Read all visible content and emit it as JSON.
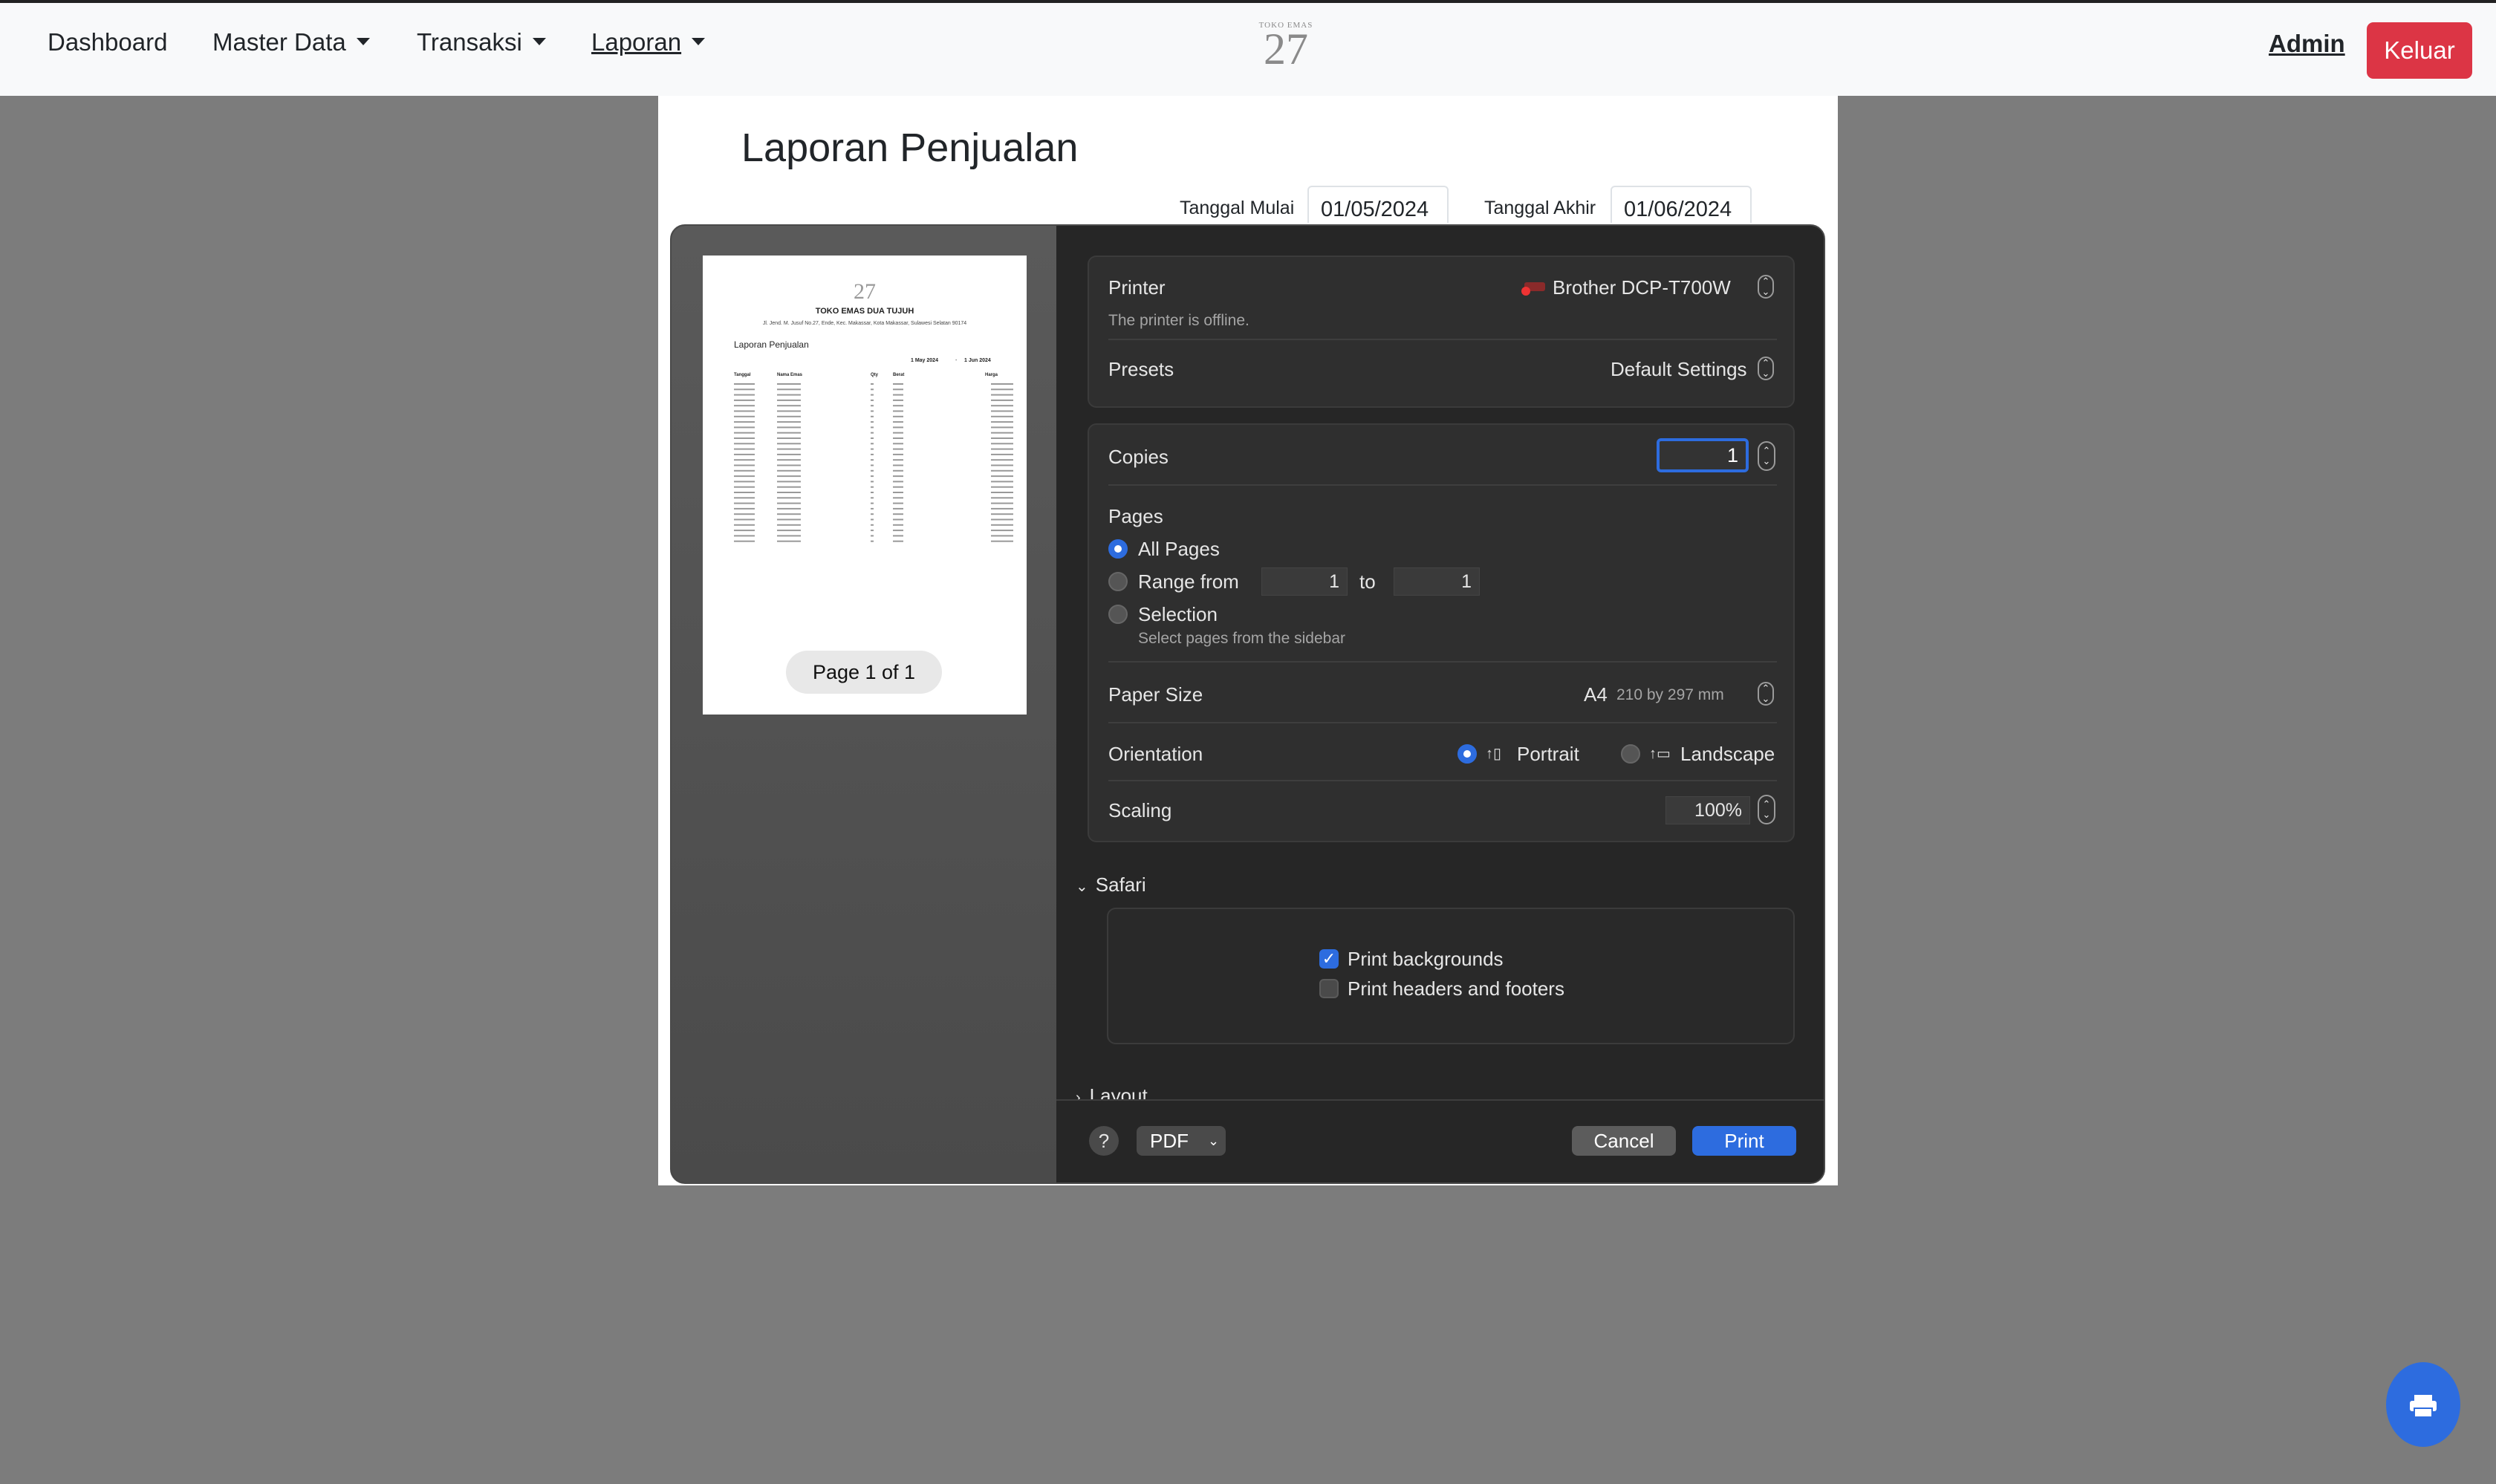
{
  "navbar": {
    "dashboard": "Dashboard",
    "master_data": "Master Data",
    "transaksi": "Transaksi",
    "laporan": "Laporan",
    "logo_small": "TOKO EMAS",
    "logo_big": "27",
    "admin": "Admin",
    "logout": "Keluar"
  },
  "report": {
    "title": "Laporan Penjualan",
    "start_label": "Tanggal Mulai",
    "start_value": "01/05/2024",
    "end_label": "Tanggal Akhir",
    "end_value": "01/06/2024"
  },
  "preview": {
    "logo": "27",
    "store_name": "TOKO EMAS DUA TUJUH",
    "address": "Jl. Jend. M. Jusuf No.27, Ende, Kec. Makassar, Kota Makassar, Sulawesi Selatan 90174",
    "title": "Laporan Penjualan",
    "date_from": "1 May 2024",
    "date_sep": "-",
    "date_to": "1 Jun 2024",
    "columns": [
      "Tanggal",
      "Nama Emas",
      "Qty",
      "Berat",
      "Harga"
    ],
    "page_indicator": "Page 1 of 1"
  },
  "print_dialog": {
    "printer_label": "Printer",
    "printer_value": "Brother DCP-T700W",
    "printer_status": "The printer is offline.",
    "presets_label": "Presets",
    "presets_value": "Default Settings",
    "copies_label": "Copies",
    "copies_value": "1",
    "pages_label": "Pages",
    "all_pages": "All Pages",
    "range_from": "Range from",
    "range_start": "1",
    "range_to": "to",
    "range_end": "1",
    "selection": "Selection",
    "selection_hint": "Select pages from the sidebar",
    "paper_size_label": "Paper Size",
    "paper_size_value": "A4",
    "paper_size_detail": "210 by 297 mm",
    "orientation_label": "Orientation",
    "portrait": "Portrait",
    "landscape": "Landscape",
    "scaling_label": "Scaling",
    "scaling_value": "100%",
    "safari_section": "Safari",
    "print_backgrounds": "Print backgrounds",
    "print_headers": "Print headers and footers",
    "layout_section": "Layout",
    "help": "?",
    "pdf": "PDF",
    "cancel": "Cancel",
    "print": "Print"
  },
  "colors": {
    "accent": "#2d6cdf",
    "danger": "#dc3545",
    "backdrop": "#7c7c7c"
  }
}
